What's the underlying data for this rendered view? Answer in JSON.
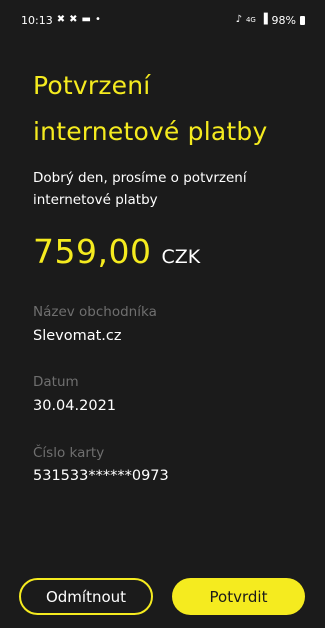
{
  "status_bar": {
    "time": "10:13",
    "left_icons": [
      "tools-icon",
      "tools-icon",
      "message-icon",
      "dot-icon"
    ],
    "signal_text": "4G",
    "battery_text": "98%"
  },
  "header": {
    "title_line1": "Potvrzení",
    "title_line2": "internetové platby"
  },
  "main": {
    "subtitle": "Dobrý den, prosíme o potvrzení internetové platby",
    "amount": "759,00",
    "currency": "CZK",
    "merchant_label": "Název obchodníka",
    "merchant_value": "Slevomat.cz",
    "date_label": "Datum",
    "date_value": "30.04.2021",
    "card_label": "Číslo karty",
    "card_value": "531533******0973"
  },
  "actions": {
    "reject_label": "Odmítnout",
    "confirm_label": "Potvrdit"
  },
  "colors": {
    "accent": "#f5eb1f",
    "background": "#1b1b1b",
    "label_gray": "#6f6f6f"
  }
}
